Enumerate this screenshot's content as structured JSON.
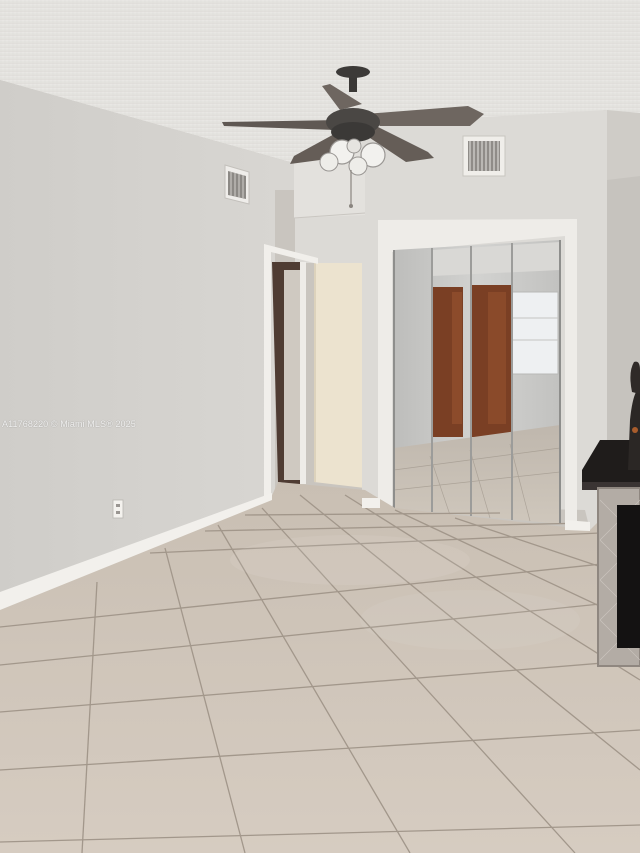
{
  "watermark": {
    "text": "A11768220 © Miami MLS® 2025"
  },
  "colors": {
    "ceiling": "#e4e2df",
    "left_wall": "#d6d4d0",
    "back_wall": "#dcdad6",
    "floor_tile": "#cfc4b8",
    "grout": "#9a8f84",
    "baseboard": "#f2f0ec",
    "door": "#ece3cf",
    "fan_blade": "#6e6660",
    "mirror": "#c8c8c6",
    "wardrobe": "#7a3f24",
    "cabinet": "#2a2624"
  },
  "icons": {
    "ceiling_fan": "ceiling-fan-icon",
    "air_vent": "air-vent-icon",
    "outlet": "outlet-icon"
  }
}
